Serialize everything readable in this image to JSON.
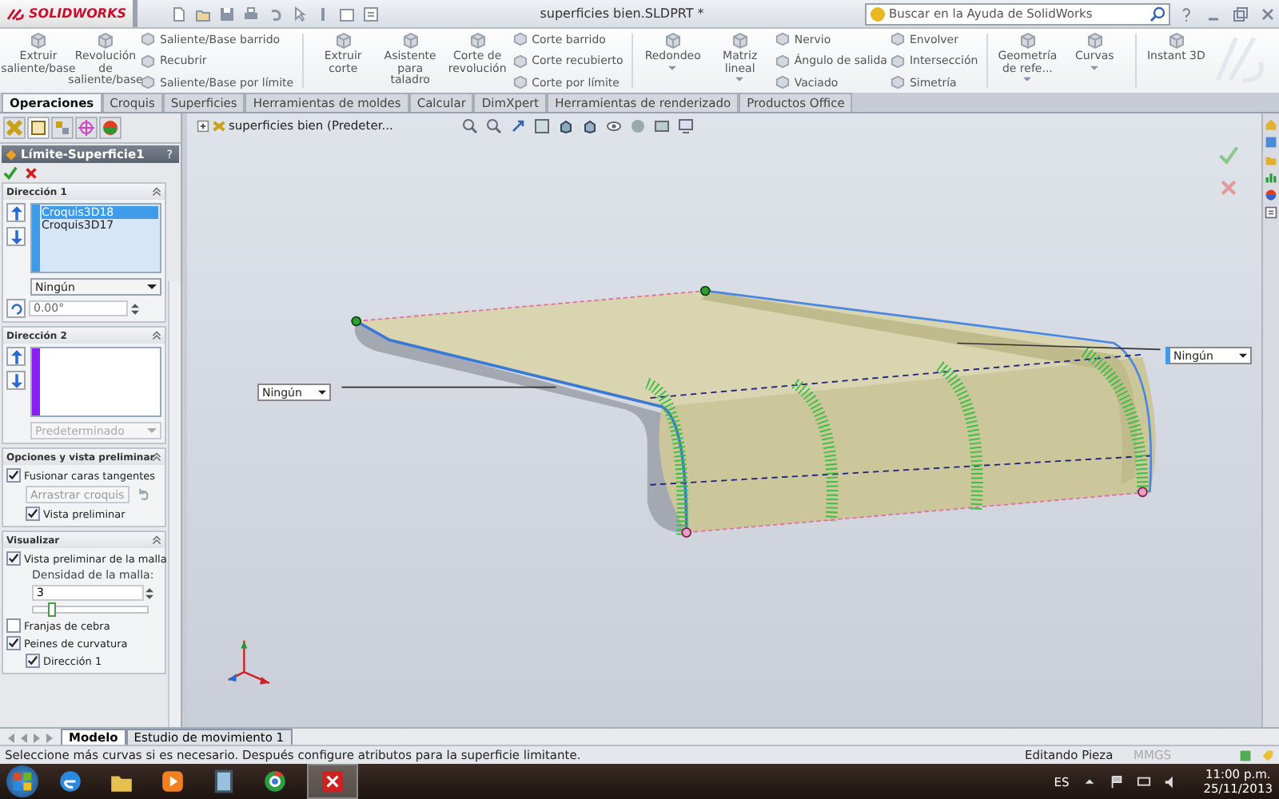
{
  "app": {
    "logo": "SOLIDWORKS",
    "title": "superficies bien.SLDPRT *",
    "search_placeholder": "Buscar en la Ayuda de SolidWorks"
  },
  "ribbon": {
    "groups": [
      [
        {
          "kind": "large",
          "label": "Extruir saliente/base",
          "has_menu": false
        },
        {
          "kind": "large",
          "label": "Revolución de saliente/base",
          "has_menu": false
        },
        {
          "kind": "stack",
          "items": [
            "Saliente/Base barrido",
            "Recubrir",
            "Saliente/Base por límite"
          ]
        }
      ],
      [
        {
          "kind": "large",
          "label": "Extruir corte",
          "has_menu": false
        },
        {
          "kind": "large",
          "label": "Asistente para taladro",
          "has_menu": false
        },
        {
          "kind": "large",
          "label": "Corte de revolución",
          "has_menu": false
        },
        {
          "kind": "stack",
          "items": [
            "Corte barrido",
            "Corte recubierto",
            "Corte por límite"
          ]
        }
      ],
      [
        {
          "kind": "large",
          "label": "Redondeo",
          "has_menu": true
        },
        {
          "kind": "large",
          "label": "Matriz lineal",
          "has_menu": true
        },
        {
          "kind": "stack",
          "items": [
            "Nervio",
            "Ángulo de salida",
            "Vaciado"
          ]
        },
        {
          "kind": "stack",
          "items": [
            "Envolver",
            "Intersección",
            "Simetría"
          ]
        }
      ],
      [
        {
          "kind": "large",
          "label": "Geometría de refe...",
          "has_menu": true
        },
        {
          "kind": "large",
          "label": "Curvas",
          "has_menu": true
        }
      ],
      [
        {
          "kind": "large",
          "label": "Instant 3D",
          "has_menu": false
        }
      ]
    ]
  },
  "tabs": [
    {
      "label": "Operaciones",
      "selected": true
    },
    {
      "label": "Croquis",
      "selected": false
    },
    {
      "label": "Superficies",
      "selected": false
    },
    {
      "label": "Herramientas de moldes",
      "selected": false
    },
    {
      "label": "Calcular",
      "selected": false
    },
    {
      "label": "DimXpert",
      "selected": false
    },
    {
      "label": "Herramientas de renderizado",
      "selected": false
    },
    {
      "label": "Productos Office",
      "selected": false
    }
  ],
  "property_manager": {
    "title": "Límite-Superficie1",
    "help": "?",
    "sections": [
      {
        "kind": "direction",
        "title": "Dirección 1",
        "expanded": true,
        "color": "#3d9be9",
        "items": [
          {
            "label": "Croquis3D18",
            "selected": true
          },
          {
            "label": "Croquis3D17",
            "selected": false
          }
        ],
        "dropdown": {
          "value": "Ningún",
          "disabled": false
        },
        "angle": "0.00°"
      },
      {
        "kind": "direction",
        "title": "Dirección 2",
        "expanded": true,
        "color": "#8a1ef0",
        "dropdown": {
          "value": "Predeterminado",
          "disabled": true
        }
      },
      {
        "kind": "controls",
        "title": "Opciones y vista preliminar",
        "expanded": true,
        "controls": [
          {
            "kind": "checkbox",
            "label": "Fusionar caras tangentes",
            "checked": true
          },
          {
            "kind": "button",
            "label": "Arrastrar croquis",
            "disabled": true
          },
          {
            "kind": "sub_checkbox",
            "label": "Vista preliminar",
            "checked": true
          }
        ]
      },
      {
        "kind": "controls",
        "title": "Visualizar",
        "expanded": true,
        "controls": [
          {
            "kind": "checkbox",
            "label": "Vista preliminar de la malla",
            "checked": true
          },
          {
            "kind": "label",
            "label": "Densidad de la malla:"
          },
          {
            "kind": "spin",
            "value": "3"
          },
          {
            "kind": "slider",
            "level": 0.15
          },
          {
            "kind": "checkbox",
            "label": "Franjas de cebra",
            "checked": false
          },
          {
            "kind": "checkbox",
            "label": "Peines de curvatura",
            "checked": true
          },
          {
            "kind": "sub_checkbox",
            "label": "Dirección 1",
            "checked": true
          }
        ]
      }
    ]
  },
  "viewport": {
    "tree_label": "superficies bien  (Predeter...",
    "callouts": [
      "Ningún",
      "Ningún"
    ]
  },
  "bottom_tabs": [
    {
      "label": "Modelo",
      "selected": true
    },
    {
      "label": "Estudio de movimiento 1",
      "selected": false
    }
  ],
  "status_bar": {
    "message": "Seleccione más curvas si es necesario. Después configure atributos para la superficie limitante.",
    "mode": "Editando Pieza",
    "units": "MMGS"
  },
  "taskbar": {
    "language": "ES",
    "time": "11:00 p.m.",
    "date": "25/11/2013"
  }
}
